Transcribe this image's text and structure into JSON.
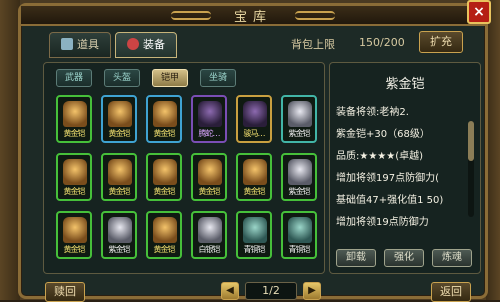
{
  "window": {
    "title": "宝库",
    "close_label": "×"
  },
  "tabs": [
    {
      "label": "道具"
    },
    {
      "label": "装备"
    }
  ],
  "capacity": {
    "label": "背包上限",
    "value": "150/200"
  },
  "expand_label": "扩充",
  "filters": [
    {
      "label": "武器"
    },
    {
      "label": "头盔"
    },
    {
      "label": "铠甲"
    },
    {
      "label": "坐骑"
    }
  ],
  "selected_filter": "铠甲",
  "grid": {
    "rows": [
      [
        {
          "name": "黄金铠",
          "quality": "green",
          "art": "gold",
          "label_color": "y"
        },
        {
          "name": "黄金铠",
          "quality": "blue",
          "art": "gold",
          "label_color": "y"
        },
        {
          "name": "黄金铠",
          "quality": "blue",
          "art": "gold",
          "label_color": "y"
        },
        {
          "name": "腾蛇…",
          "quality": "purple",
          "art": "dark",
          "label_color": "p"
        },
        {
          "name": "骏马…",
          "quality": "gold",
          "art": "dark",
          "label_color": "y"
        },
        {
          "name": "紫金铠",
          "quality": "teal",
          "art": "silver",
          "label_color": "w"
        }
      ],
      [
        {
          "name": "黄金铠",
          "quality": "green",
          "art": "gold",
          "label_color": "y"
        },
        {
          "name": "黄金铠",
          "quality": "green",
          "art": "gold",
          "label_color": "y"
        },
        {
          "name": "黄金铠",
          "quality": "green",
          "art": "gold",
          "label_color": "y"
        },
        {
          "name": "黄金铠",
          "quality": "green",
          "art": "gold",
          "label_color": "y"
        },
        {
          "name": "黄金铠",
          "quality": "green",
          "art": "gold",
          "label_color": "y"
        },
        {
          "name": "紫金铠",
          "quality": "green",
          "art": "silver",
          "label_color": "w"
        }
      ],
      [
        {
          "name": "黄金铠",
          "quality": "green",
          "art": "gold",
          "label_color": "y"
        },
        {
          "name": "紫金铠",
          "quality": "green",
          "art": "silver",
          "label_color": "w"
        },
        {
          "name": "黄金铠",
          "quality": "green",
          "art": "gold",
          "label_color": "y"
        },
        {
          "name": "白银铠",
          "quality": "green",
          "art": "silver",
          "label_color": "w"
        },
        {
          "name": "青铜铠",
          "quality": "green",
          "art": "teal",
          "label_color": "w"
        },
        {
          "name": "青铜铠",
          "quality": "green",
          "art": "teal",
          "label_color": "w"
        }
      ]
    ]
  },
  "pager": {
    "text": "1/2",
    "prev": "◀",
    "next": "▶"
  },
  "restore_label": "赎回",
  "back_label": "返回",
  "detail": {
    "name": "紫金铠",
    "lines": [
      {
        "text": "装备将领:老衲2.",
        "style": ""
      },
      {
        "text": "紫金铠+30（68级）",
        "style": ""
      },
      {
        "text": "品质:★★★★(卓越)",
        "style": ""
      },
      {
        "text": "增加将领197点防御力(",
        "style": ""
      },
      {
        "text": "基础值47+强化值1 50)",
        "style": ""
      },
      {
        "text": "增加将领19点防御力",
        "style": ""
      }
    ],
    "actions": [
      {
        "label": "卸载"
      },
      {
        "label": "强化"
      },
      {
        "label": "炼魂"
      }
    ]
  }
}
